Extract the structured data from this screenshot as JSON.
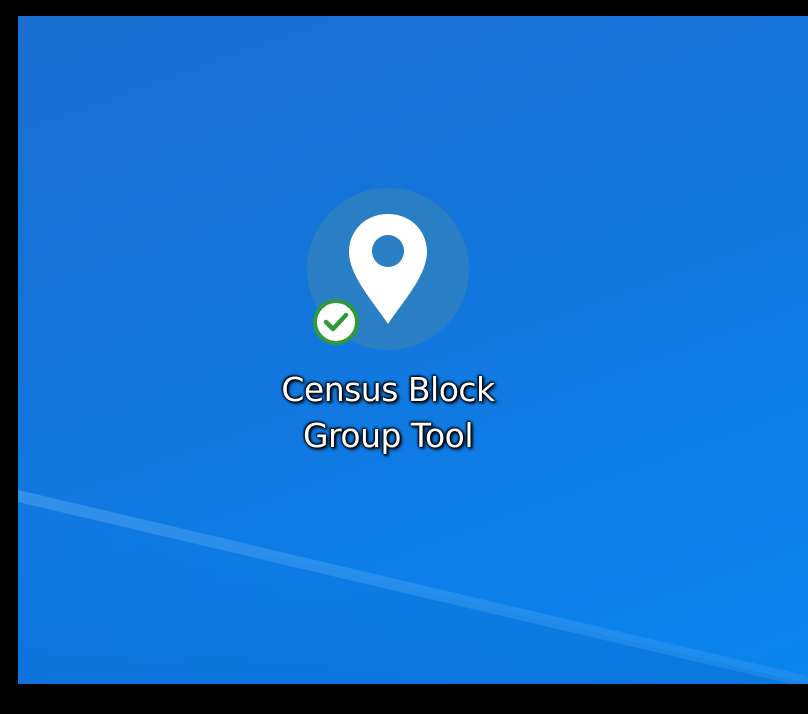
{
  "desktop": {
    "icons": [
      {
        "label_line1": "Census Block",
        "label_line2": "Group Tool",
        "icon": "map-pin-icon",
        "overlay_badge": "sync-check-icon"
      }
    ]
  },
  "colors": {
    "desktop_background": "#1474d8",
    "icon_circle": "#2a7fc4",
    "pin": "#ffffff",
    "badge_border": "#2e9a3c",
    "badge_check": "#2e9a3c"
  }
}
